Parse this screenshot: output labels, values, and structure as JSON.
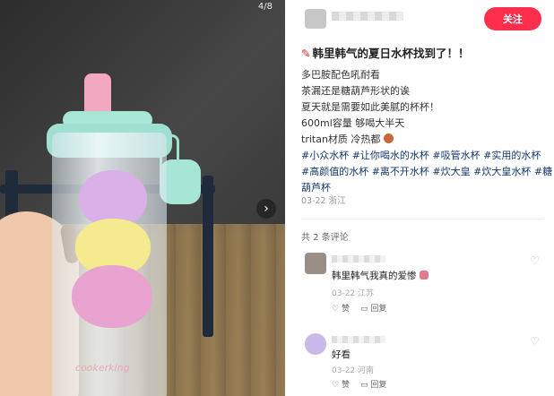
{
  "image": {
    "counter": "4/8",
    "next_icon": "chevron-right-icon",
    "brand_text": "cookerking"
  },
  "author": {
    "name": "",
    "follow_label": "关注"
  },
  "post": {
    "title": "韩里韩气的夏日水杯找到了！！",
    "lines": [
      "多巴胺配色吼耐看",
      "茶漏还是糖葫芦形状的诶",
      "夏天就是需要如此美腻的杯杯！",
      "600ml容量 够喝大半天",
      "tritan材质 冷热都"
    ],
    "tags_line1": "#小众水杯 #让你喝水的水杯 #吸管水杯 #实用的水杯",
    "tags_line2": "#高颜值的水杯 #离不开水杯 #炊大皇 #炊大皇水杯 #糖",
    "tags_line3": "葫芦杯",
    "date": "03-22 浙江"
  },
  "comments": {
    "count_label": "共 2 条评论",
    "items": [
      {
        "text": "韩里韩气我真的爱惨",
        "meta": "03-22 江苏",
        "like": "赞",
        "reply": "回复"
      },
      {
        "text": "好看",
        "meta": "03-22 河南",
        "like": "赞",
        "reply": "回复"
      }
    ]
  },
  "colors": {
    "follow_bg": "#ff2e4d",
    "tag_color": "#13386c",
    "lid": "#9fe0d0",
    "straw": "#f3a8c2"
  }
}
